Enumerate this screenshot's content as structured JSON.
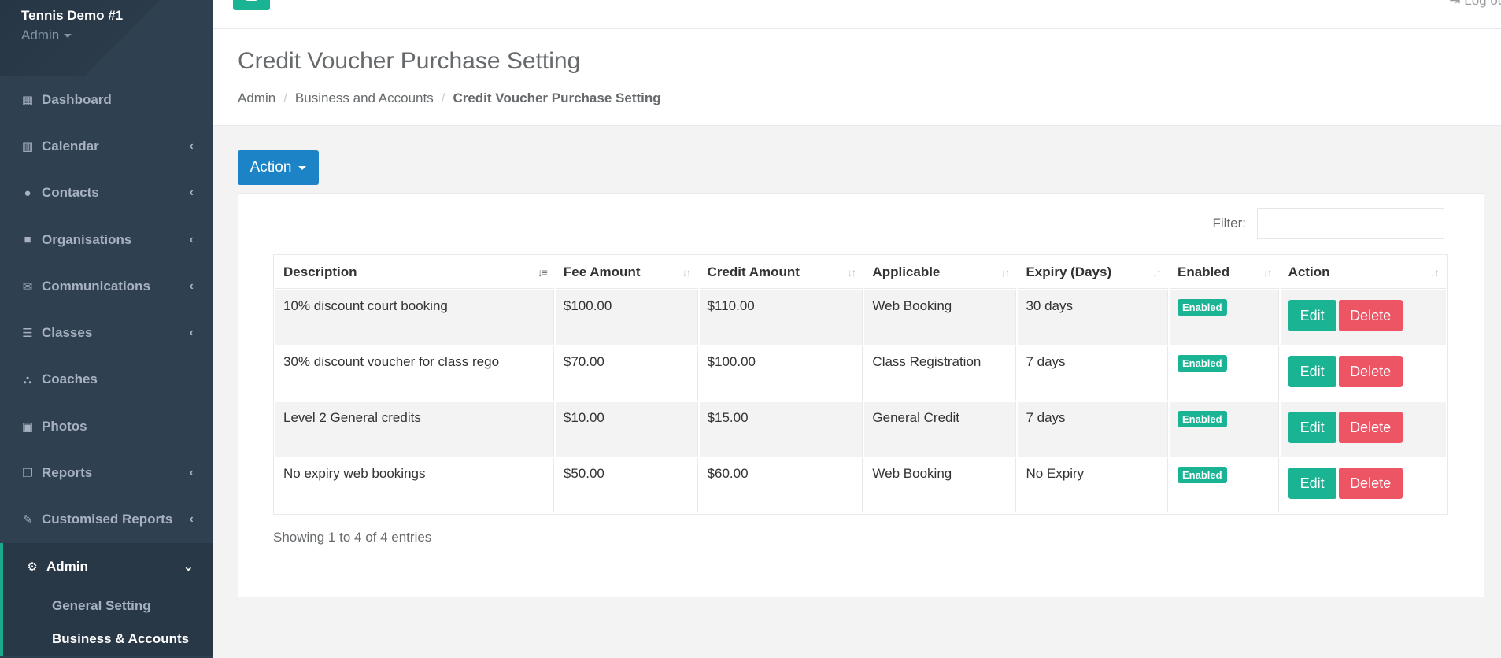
{
  "sidebar": {
    "profile_name": "Tennis Demo #1",
    "profile_role": "Admin",
    "items": [
      {
        "label": "Dashboard",
        "icon": "dashboard-icon",
        "glyph": "▦",
        "arrow": ""
      },
      {
        "label": "Calendar",
        "icon": "calendar-icon",
        "glyph": "▥",
        "arrow": "‹"
      },
      {
        "label": "Contacts",
        "icon": "user-icon",
        "glyph": "●",
        "arrow": "‹"
      },
      {
        "label": "Organisations",
        "icon": "briefcase-icon",
        "glyph": "■",
        "arrow": "‹"
      },
      {
        "label": "Communications",
        "icon": "envelope-icon",
        "glyph": "✉",
        "arrow": "‹"
      },
      {
        "label": "Classes",
        "icon": "list-icon",
        "glyph": "☰",
        "arrow": "‹"
      },
      {
        "label": "Coaches",
        "icon": "sitemap-icon",
        "glyph": "⛬",
        "arrow": ""
      },
      {
        "label": "Photos",
        "icon": "image-icon",
        "glyph": "▣",
        "arrow": ""
      },
      {
        "label": "Reports",
        "icon": "copy-icon",
        "glyph": "❐",
        "arrow": "‹"
      },
      {
        "label": "Customised Reports",
        "icon": "edit-icon",
        "glyph": "✎",
        "arrow": "‹"
      }
    ],
    "active_item": {
      "label": "Admin",
      "icon": "gear-icon",
      "glyph": "⚙",
      "arrow": "⌄"
    },
    "sub_items": [
      {
        "label": "General Setting"
      },
      {
        "label": "Business & Accounts"
      }
    ]
  },
  "topbar": {
    "logout_label": "Log out",
    "logout_glyph": "⇥"
  },
  "heading": {
    "title": "Credit Voucher Purchase Setting",
    "breadcrumb": [
      "Admin",
      "Business and Accounts",
      "Credit Voucher Purchase Setting"
    ],
    "separator": "/"
  },
  "action_button": {
    "label": "Action"
  },
  "filter": {
    "label": "Filter:",
    "value": ""
  },
  "table": {
    "columns": [
      "Description",
      "Fee Amount",
      "Credit Amount",
      "Applicable",
      "Expiry (Days)",
      "Enabled",
      "Action"
    ],
    "sort_glyph": "↓↑",
    "sorted_glyph": "↓≡",
    "rows": [
      {
        "description": "10% discount court booking",
        "fee": "$100.00",
        "credit": "$110.00",
        "applicable": "Web Booking",
        "expiry": "30 days",
        "enabled": "Enabled"
      },
      {
        "description": "30% discount voucher for class rego",
        "fee": "$70.00",
        "credit": "$100.00",
        "applicable": "Class Registration",
        "expiry": "7 days",
        "enabled": "Enabled"
      },
      {
        "description": "Level 2 General credits",
        "fee": "$10.00",
        "credit": "$15.00",
        "applicable": "General Credit",
        "expiry": "7 days",
        "enabled": "Enabled"
      },
      {
        "description": "No expiry web bookings",
        "fee": "$50.00",
        "credit": "$60.00",
        "applicable": "Web Booking",
        "expiry": "No Expiry",
        "enabled": "Enabled"
      }
    ],
    "edit_label": "Edit",
    "delete_label": "Delete",
    "info": "Showing 1 to 4 of 4 entries"
  },
  "colors": {
    "sidebar": "#2f4050",
    "accent": "#1ab394",
    "primary": "#1c84c6",
    "danger": "#ed5565"
  }
}
